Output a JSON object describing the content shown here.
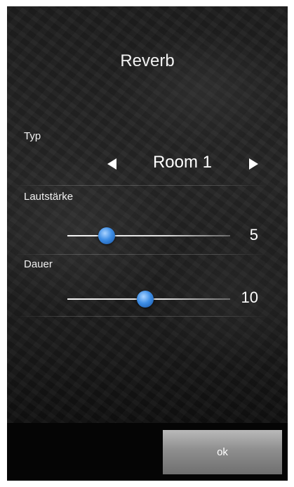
{
  "dialog": {
    "title": "Reverb"
  },
  "type": {
    "label": "Typ",
    "value": "Room 1"
  },
  "volume": {
    "label": "Lautstärke",
    "value": "5",
    "level": 0.24
  },
  "duration": {
    "label": "Dauer",
    "value": "10",
    "level": 0.48
  },
  "footer": {
    "ok_label": "ok"
  },
  "colors": {
    "slider_thumb": "#3e8ee6",
    "ok_button": "#8e8e8e"
  }
}
